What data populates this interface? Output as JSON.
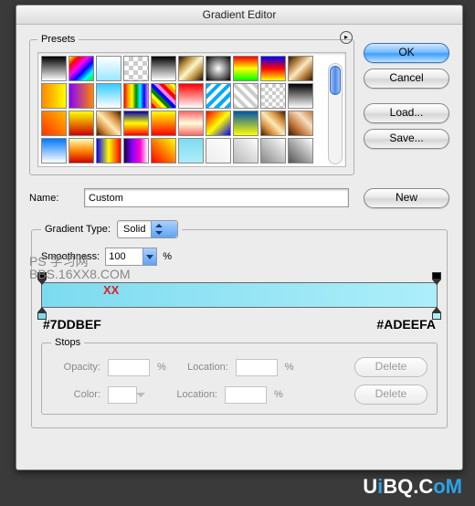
{
  "title": "Gradient Editor",
  "presets_label": "Presets",
  "preset_gradients": [
    "linear-gradient(#000,#fff)",
    "linear-gradient(135deg,#ff0,#f00,#f0f,#00f,#0ff,#0f0)",
    "linear-gradient(#fff,#9be7ff)",
    "repeating-conic-gradient(#ccc 0 25%, #fff 0 50%) 0 0/10px 10px",
    "linear-gradient(#000,#888,#fff)",
    "linear-gradient(135deg,#111,#b58a3a,#fff6c7,#b58a3a,#111)",
    "radial-gradient(#fff,#000)",
    "linear-gradient(#f00,#ff0,#0f0)",
    "linear-gradient(#00f,#f00,#ff0)",
    "linear-gradient(135deg,#2a1a0a,#b07a3a,#fbe7c0,#b07a3a,#2a1a0a)",
    "linear-gradient(90deg,#f80,#ff0)",
    "linear-gradient(90deg,#80f,#f80)",
    "linear-gradient(#3cf,#fff)",
    "linear-gradient(90deg,red,orange,yellow,green,cyan,blue,violet)",
    "repeating-linear-gradient(45deg,red 0 4px,orange 4px 8px,yellow 8px 12px,green 12px 16px,blue 16px 20px,violet 20px 24px)",
    "linear-gradient(#f00,#fff)",
    "repeating-linear-gradient(135deg,#0af 0 4px,#fff 4px 8px)",
    "repeating-linear-gradient(45deg,#ccc 0 4px,#fff 4px 8px)",
    "repeating-conic-gradient(#ccc 0 25%, #fff 0 50%) 0 0/8px 8px",
    "linear-gradient(#000,#fff)",
    "linear-gradient(45deg,#f30,#fb0)",
    "linear-gradient(#ff0,#c00)",
    "linear-gradient(45deg,#3a1c00,#d28a3a,#ffe9b0,#d28a3a,#3a1c00)",
    "linear-gradient(#00a,#ff0,#f00)",
    "linear-gradient(#ff0,#f00)",
    "linear-gradient(#f66,#ffd,#f66)",
    "linear-gradient(135deg,#f00,#ff0,#00f)",
    "linear-gradient(#05a,#ff0)",
    "linear-gradient(45deg,#3a1c00,#d28a3a,#ffe9b0,#d28a3a,#3a1c00)",
    "linear-gradient(45deg,#3a1c00,#c4773a,#f7dfbf,#c4773a)",
    "linear-gradient(#07f,#fff)",
    "linear-gradient(#ffb,#f80,#c00)",
    "linear-gradient(90deg,#00f,#ff0,#f00)",
    "linear-gradient(90deg,#104,#80f,#f0c,#fff)",
    "linear-gradient(45deg,#f00,#ff0)",
    "linear-gradient(#7ddbef,#adeefa)",
    "linear-gradient(45deg,#ececec,#fff)",
    "linear-gradient(45deg,#b8b8b8,#fff)",
    "linear-gradient(45deg,#888,#fff)",
    "linear-gradient(45deg,#555,#fff)"
  ],
  "buttons": {
    "ok": "OK",
    "cancel": "Cancel",
    "load": "Load...",
    "save": "Save...",
    "new": "New",
    "delete": "Delete"
  },
  "name_label": "Name:",
  "name_value": "Custom",
  "gradient_type_label": "Gradient Type:",
  "gradient_type_value": "Solid",
  "smoothness_label": "Smoothness:",
  "smoothness_value": "100",
  "percent": "%",
  "stops_label": "Stops",
  "opacity_label": "Opacity:",
  "color_label": "Color:",
  "location_label": "Location:",
  "hex_left": "#7DDBEF",
  "hex_right": "#ADEEFA",
  "watermark_line1": "PS 学习网",
  "watermark_line2": "BBS.16XX8.COM",
  "xx_mark": "XX",
  "footer_logo_plain": "UBQ.C",
  "footer_logo_i": "i",
  "footer_logo_o": "o",
  "footer_logo_m": "M",
  "chart_data": {
    "type": "gradient",
    "stops": [
      {
        "position": 0,
        "color": "#7DDBEF"
      },
      {
        "position": 100,
        "color": "#ADEEFA"
      }
    ],
    "smoothness": 100,
    "gradient_type": "Solid"
  }
}
